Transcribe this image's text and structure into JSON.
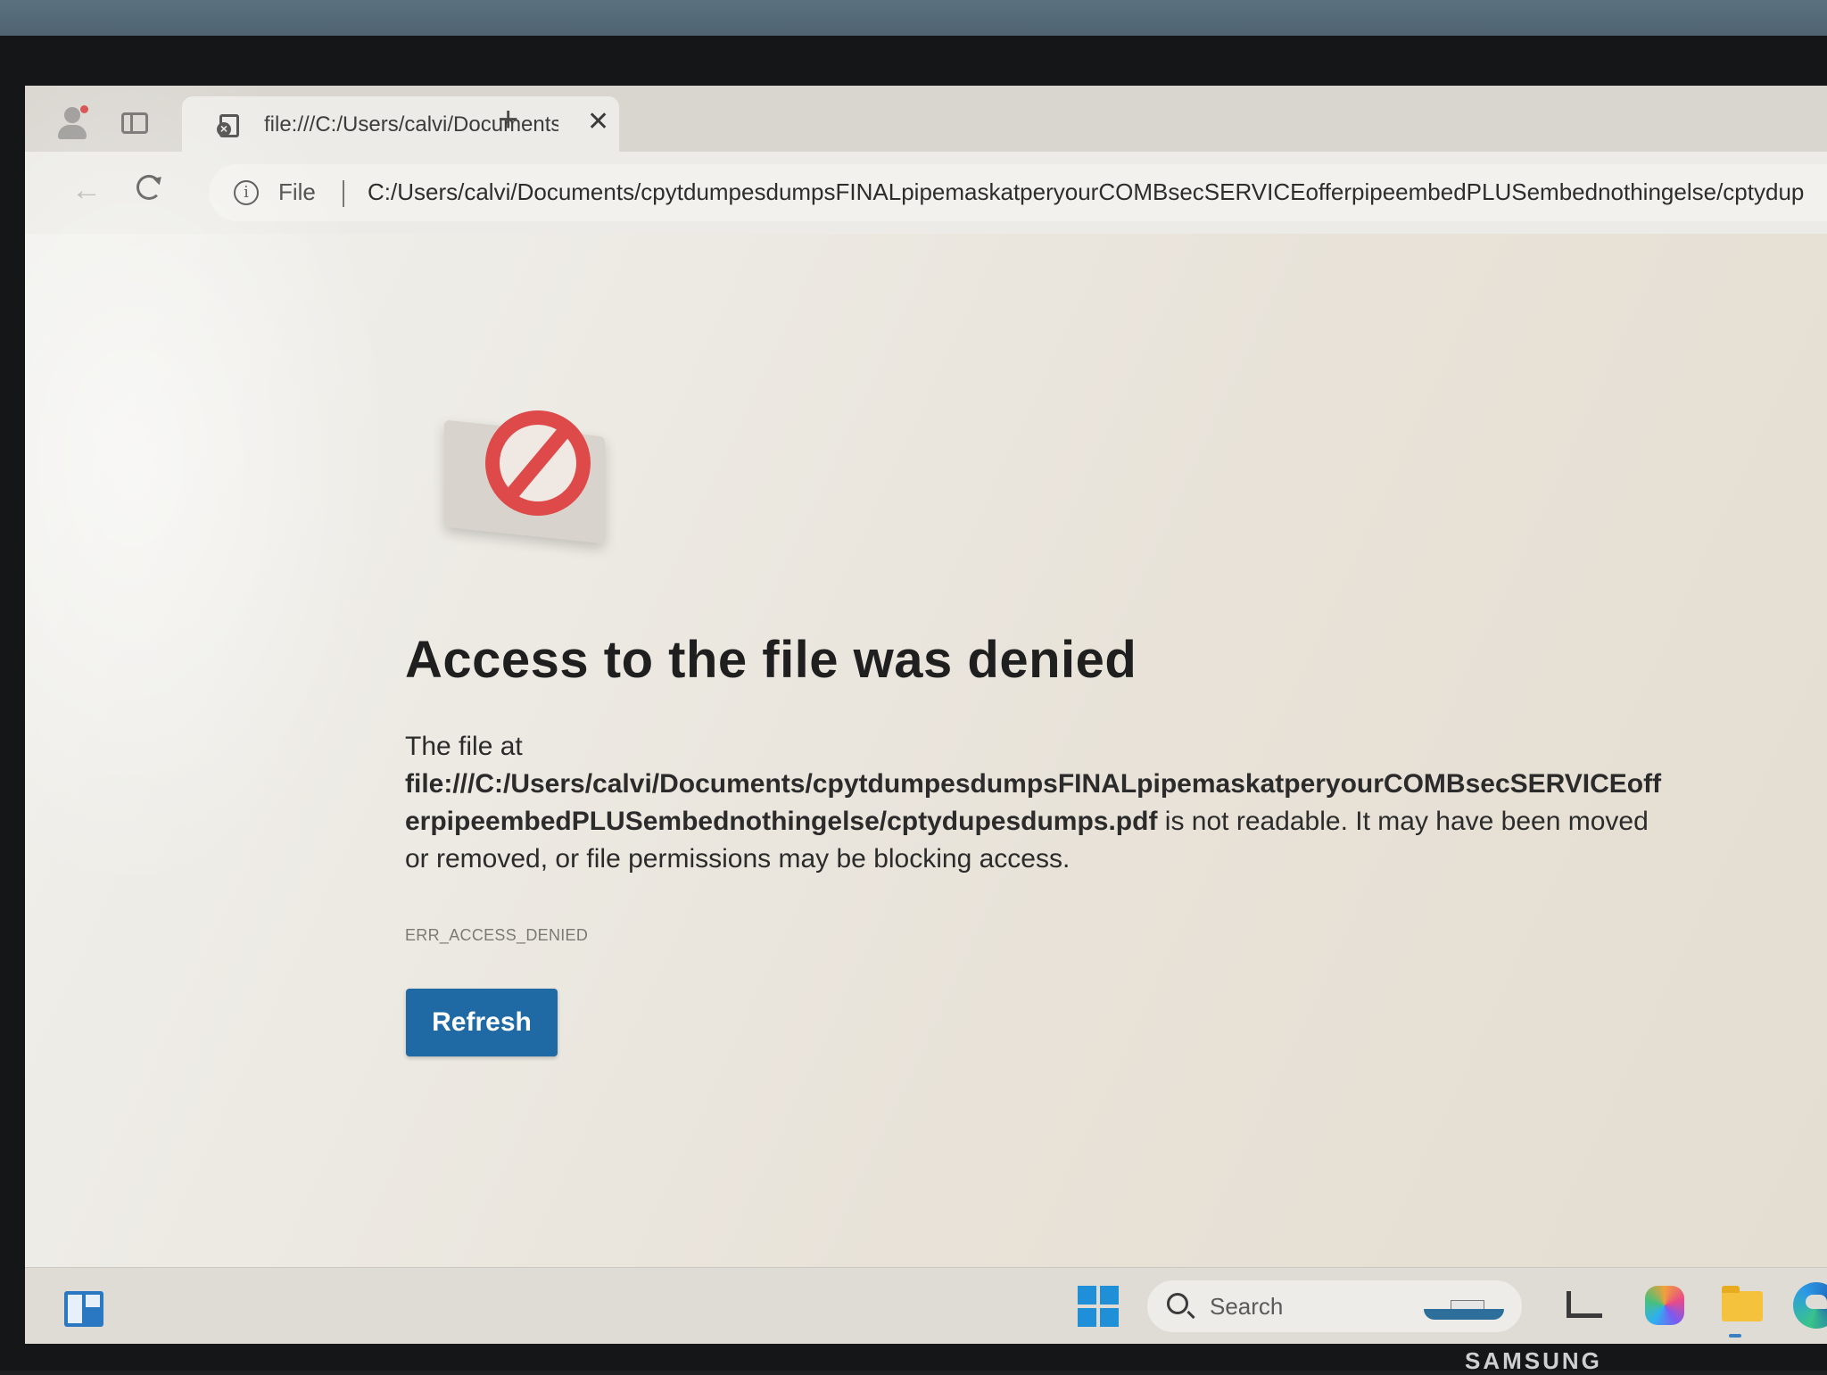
{
  "browser": {
    "tab": {
      "title": "file:///C:/Users/calvi/Documents/c",
      "close_glyph": "✕"
    },
    "new_tab_glyph": "+",
    "address_bar": {
      "scheme_chip": "File",
      "url": "C:/Users/calvi/Documents/cpytdumpesdumpsFINALpipemaskatperyourCOMBsecSERVICEofferpipeembedPLUSembednothingelse/cptydup"
    }
  },
  "page": {
    "heading": "Access to the file was denied",
    "description_prefix": "The file at",
    "file_path": "file:///C:/Users/calvi/Documents/cpytdumpesdumpsFINALpipemaskatperyourCOMBsecSERVICEofferpipeembedPLUSembednothingelse/cptydupesdumps.pdf",
    "description_suffix": " is not readable. It may have been moved or removed, or file permissions may be blocking access.",
    "error_code": "ERR_ACCESS_DENIED",
    "refresh_button": "Refresh"
  },
  "taskbar": {
    "search_label": "Search"
  },
  "monitor": {
    "brand": "SAMSUNG"
  },
  "colors": {
    "refresh_button": "#1f6aa5",
    "error_sign": "#de4a4a"
  },
  "icons": [
    "profile-icon",
    "tab-actions-icon",
    "file-error-icon",
    "reload-icon",
    "info-icon",
    "no-entry-icon",
    "widgets-icon",
    "windows-start-icon",
    "search-icon",
    "task-view-icon",
    "copilot-icon",
    "file-explorer-icon",
    "edge-icon"
  ]
}
